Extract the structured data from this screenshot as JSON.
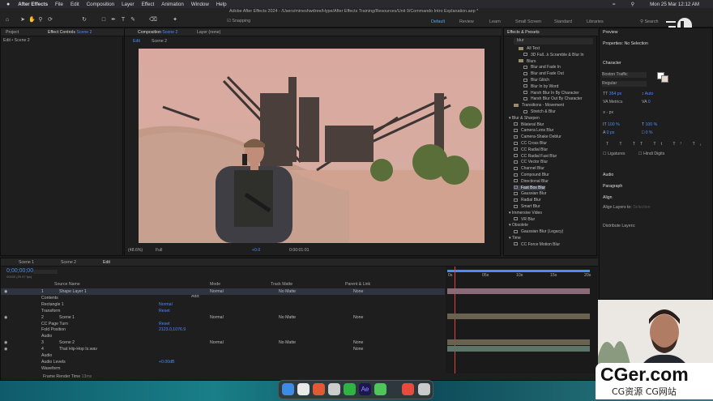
{
  "menubar": {
    "apple": "",
    "app": "After Effects",
    "items": [
      "File",
      "Edit",
      "Composition",
      "Layer",
      "Effect",
      "Animation",
      "Window",
      "Help"
    ],
    "datetime": "Mon 25 Mar  12:12 AM"
  },
  "window_title": "Adobe After Effects 2024 - /Users/mineshwdree/Hype/After Effects Training/Resources/Unit 9/Commando Intro Explanation.aep *",
  "toolbar": {
    "snapping": "Snapping",
    "workspaces": [
      "Default",
      "Review",
      "Learn",
      "Small Screen",
      "Standard",
      "Libraries"
    ],
    "active_workspace": "Default",
    "search_label": "Search"
  },
  "left_panel": {
    "tabs": [
      "Project",
      "Effect Controls"
    ],
    "effect_layer": "Scene 2",
    "sub": "Edit • Scene 2"
  },
  "comp_panel": {
    "tab": "Composition",
    "comp_name": "Scene 2",
    "layer_tab": "Layer (none)",
    "breadcrumb": [
      "Edit",
      "Scene 2"
    ],
    "zoom": "(48.6%)",
    "quality": "Full",
    "exposure": "+0.0",
    "timecode": "0:00:01:01"
  },
  "effects_panel": {
    "title": "Effects & Presets",
    "search_value": "blur",
    "items": [
      {
        "indent": 2,
        "type": "sub",
        "label": "All Text"
      },
      {
        "indent": 3,
        "type": "fx",
        "label": "3D Fall...k Scramble & Blur In"
      },
      {
        "indent": 2,
        "type": "folder",
        "label": "Blurs"
      },
      {
        "indent": 3,
        "type": "fx",
        "label": "Blur and Fade In"
      },
      {
        "indent": 3,
        "type": "fx",
        "label": "Blur and Fade Out"
      },
      {
        "indent": 3,
        "type": "fx",
        "label": "Blur Glitch"
      },
      {
        "indent": 3,
        "type": "fx",
        "label": "Blur In by Word"
      },
      {
        "indent": 3,
        "type": "fx",
        "label": "Harsh Blur In By Character"
      },
      {
        "indent": 3,
        "type": "fx",
        "label": "Harsh Blur Out By Character"
      },
      {
        "indent": 1,
        "type": "folder",
        "label": "Transitions - Movement"
      },
      {
        "indent": 3,
        "type": "fx",
        "label": "Stretch & Blur"
      },
      {
        "indent": 0,
        "type": "cat",
        "label": "Blur & Sharpen"
      },
      {
        "indent": 1,
        "type": "fx",
        "label": "Bilateral Blur"
      },
      {
        "indent": 1,
        "type": "fx",
        "label": "Camera Lens Blur"
      },
      {
        "indent": 1,
        "type": "fx",
        "label": "Camera-Shake Deblur"
      },
      {
        "indent": 1,
        "type": "fx",
        "label": "CC Cross Blur"
      },
      {
        "indent": 1,
        "type": "fx",
        "label": "CC Radial Blur"
      },
      {
        "indent": 1,
        "type": "fx",
        "label": "CC Radial Fast Blur"
      },
      {
        "indent": 1,
        "type": "fx",
        "label": "CC Vector Blur"
      },
      {
        "indent": 1,
        "type": "fx",
        "label": "Channel Blur"
      },
      {
        "indent": 1,
        "type": "fx",
        "label": "Compound Blur"
      },
      {
        "indent": 1,
        "type": "fx",
        "label": "Directional Blur"
      },
      {
        "indent": 1,
        "type": "fx",
        "label": "Fast Box Blur",
        "selected": true
      },
      {
        "indent": 1,
        "type": "fx",
        "label": "Gaussian Blur"
      },
      {
        "indent": 1,
        "type": "fx",
        "label": "Radial Blur"
      },
      {
        "indent": 1,
        "type": "fx",
        "label": "Smart Blur"
      },
      {
        "indent": 0,
        "type": "cat",
        "label": "Immersive Video"
      },
      {
        "indent": 1,
        "type": "fx",
        "label": "VR Blur"
      },
      {
        "indent": 0,
        "type": "cat",
        "label": "Obsolete"
      },
      {
        "indent": 1,
        "type": "fx",
        "label": "Gaussian Blur (Legacy)"
      },
      {
        "indent": 0,
        "type": "cat",
        "label": "Time"
      },
      {
        "indent": 1,
        "type": "fx",
        "label": "CC Force Motion Blur"
      }
    ]
  },
  "right_panel": {
    "preview": "Preview",
    "properties": "Properties: No Selection",
    "character": "Character",
    "font": "Boston Traffic",
    "style": "Regular",
    "size": "354 px",
    "leading": "Auto",
    "kerning": "Metrics",
    "tracking": "0",
    "stroke": "- px",
    "vscale": "100 %",
    "hscale": "100 %",
    "baseline": "0 px",
    "tsume": "0 %",
    "ligatures": "Ligatures",
    "hindi": "Hindi Digits",
    "audio": "Audio",
    "paragraph": "Paragraph",
    "align": "Align",
    "align_to": "Align Layers to:",
    "align_to_val": "Selection",
    "distribute": "Distribute Layers:"
  },
  "timeline": {
    "tabs": [
      "Scene 1",
      "Scene 2",
      "Edit"
    ],
    "active_tab": "Edit",
    "timecode": "0;00;00;00",
    "fps": "00000 (29.97 fps)",
    "col_source": "Source Name",
    "col_mode": "Mode",
    "col_trkmat": "Track Matte",
    "col_parent": "Parent & Link",
    "rows": [
      {
        "num": "1",
        "name": "Shape Layer 1",
        "mode": "Normal",
        "matte": "No Matte",
        "parent": "None",
        "selected": true
      },
      {
        "sub": "Contents"
      },
      {
        "sub": "Rectangle 1",
        "val": "Normal"
      },
      {
        "sub": "Transform",
        "val": "Reset"
      },
      {
        "num": "2",
        "name": "Scene 1",
        "mode": "Normal",
        "matte": "No Matte",
        "parent": "None"
      },
      {
        "sub": "CC Page Turn",
        "val": "Reset"
      },
      {
        "sub": "Fold Position",
        "val": "2123.0,1076.9"
      },
      {
        "sub": "Audio"
      },
      {
        "num": "3",
        "name": "Scene 2",
        "mode": "Normal",
        "matte": "No Matte",
        "parent": "None"
      },
      {
        "num": "4",
        "name": "That Hip-Hop Is.wav",
        "parent": "None"
      },
      {
        "sub": "Audio"
      },
      {
        "sub": "Audio Levels",
        "val": "+0.00dB"
      },
      {
        "sub": "Waveform"
      }
    ],
    "ruler": [
      "0s",
      "05s",
      "10s",
      "15s",
      "20s"
    ],
    "footer": "Frame Render Time",
    "footer_val": "13ms",
    "add_label": "Add:"
  },
  "watermark": {
    "line1": "CGer.com",
    "line2": "CG资源 CG网站"
  },
  "colors": {
    "accent": "#4a8cff",
    "playhead": "#e04040"
  }
}
